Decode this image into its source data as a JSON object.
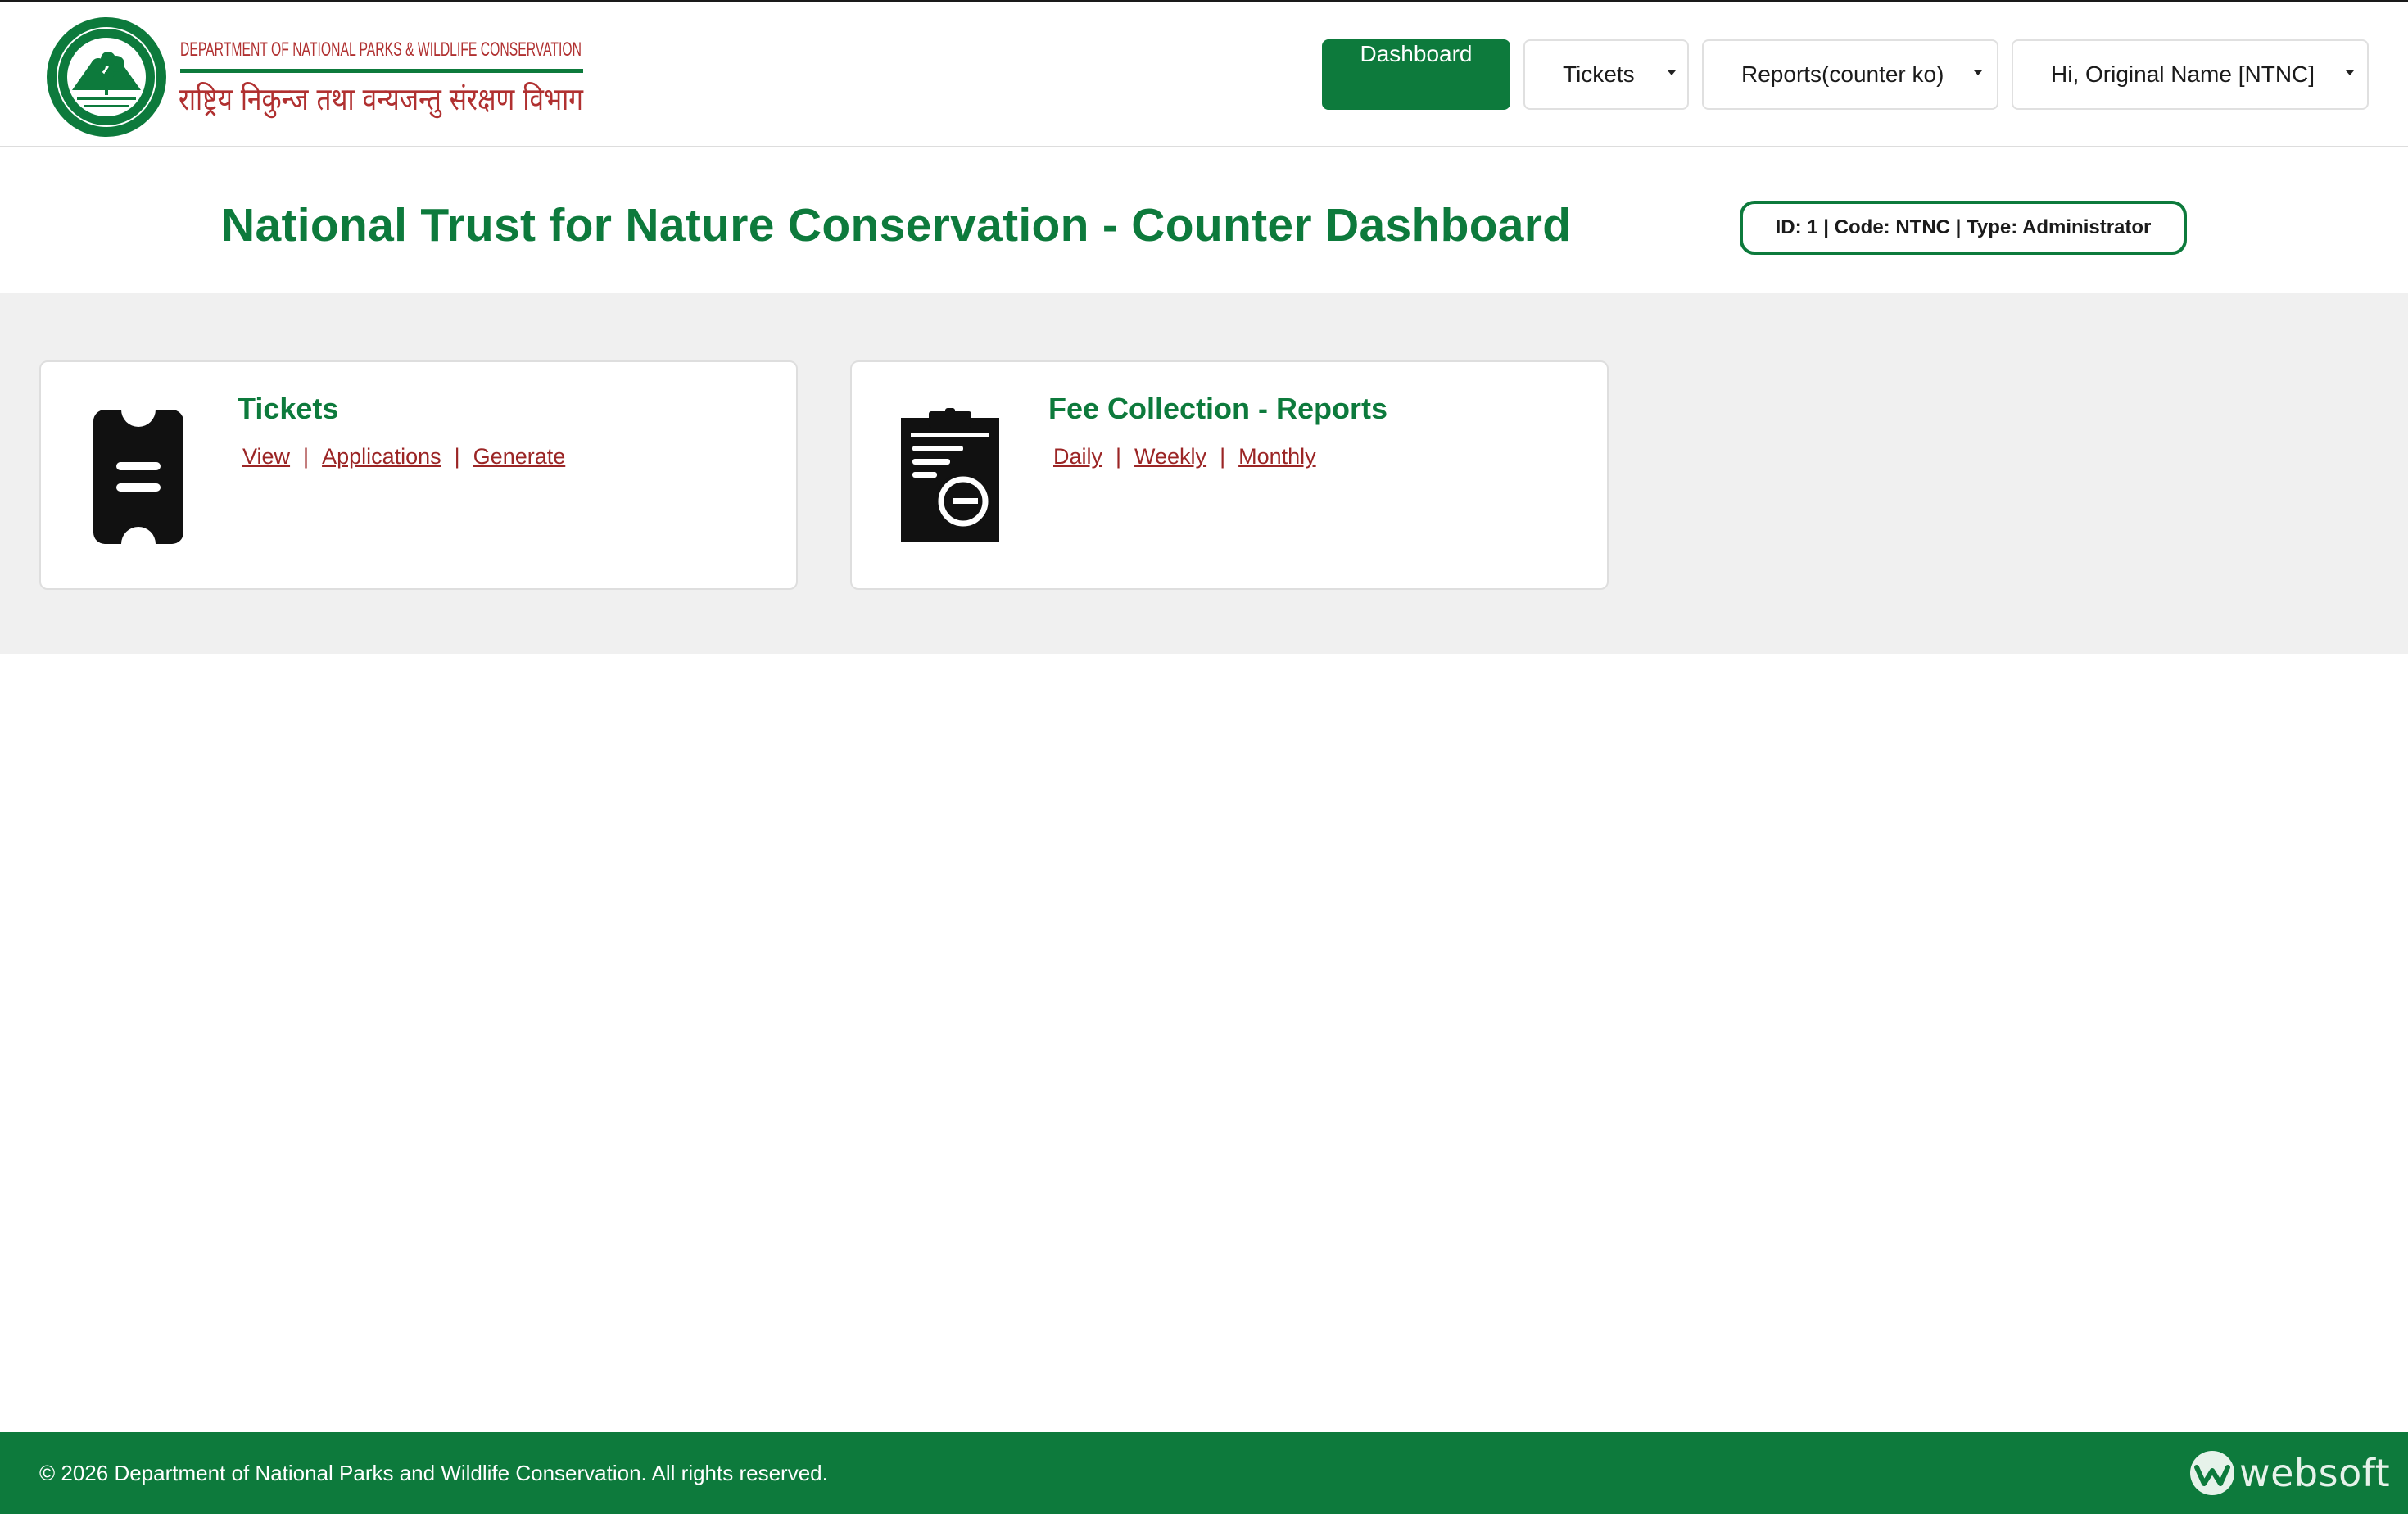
{
  "header": {
    "logo": {
      "line1": "DEPARTMENT OF NATIONAL PARKS & WILDLIFE CONSERVATION",
      "line2": "राष्ट्रिय निकुन्ज तथा वन्यजन्तु संरक्षण विभाग"
    },
    "nav": {
      "dashboard": "Dashboard",
      "tickets": "Tickets",
      "reports": "Reports(counter ko)",
      "user": "Hi, Original Name [NTNC]"
    }
  },
  "page": {
    "title": "National Trust for Nature Conservation - Counter Dashboard",
    "badge": "ID: 1 | Code: NTNC | Type: Administrator"
  },
  "cards": {
    "tickets": {
      "icon": "ticket-icon",
      "title": "Tickets",
      "links": [
        "View",
        "Applications",
        "Generate"
      ]
    },
    "fees": {
      "icon": "clipboard-report-icon",
      "title": "Fee Collection - Reports",
      "links": [
        "Daily",
        "Weekly",
        "Monthly"
      ]
    }
  },
  "footer": {
    "copyright": "© 2026 Department of National Parks and Wildlife Conservation. All rights reserved.",
    "brand": "websoft"
  },
  "colors": {
    "primary": "#0d7a3c",
    "link": "#9b2525",
    "band": "#f0f0f0",
    "logo_red": "#b03030"
  }
}
